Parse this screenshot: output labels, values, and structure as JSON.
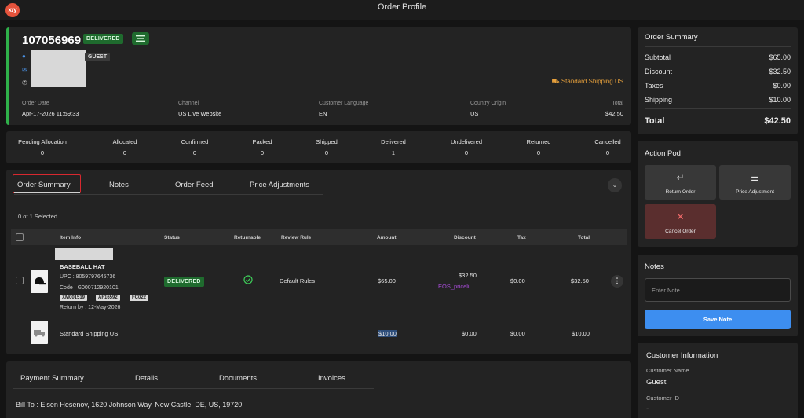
{
  "app": {
    "logo_text": "x/y",
    "title": "Order Profile"
  },
  "order": {
    "id": "107056969",
    "status_badge": "DELIVERED",
    "customer_tag": "GUEST",
    "shipping_method": "Standard Shipping US",
    "meta": [
      {
        "label": "Order Date",
        "value": "Apr-17-2026 11:59:33"
      },
      {
        "label": "Channel",
        "value": "US Live Website"
      },
      {
        "label": "Customer Language",
        "value": "EN"
      },
      {
        "label": "Country Origin",
        "value": "US"
      },
      {
        "label": "Total",
        "value": "$42.50"
      }
    ]
  },
  "status_counts": [
    {
      "label": "Pending Allocation",
      "value": "0"
    },
    {
      "label": "Allocated",
      "value": "0"
    },
    {
      "label": "Confirmed",
      "value": "0"
    },
    {
      "label": "Packed",
      "value": "0"
    },
    {
      "label": "Shipped",
      "value": "0"
    },
    {
      "label": "Delivered",
      "value": "1"
    },
    {
      "label": "Undelivered",
      "value": "0"
    },
    {
      "label": "Returned",
      "value": "0"
    },
    {
      "label": "Cancelled",
      "value": "0"
    }
  ],
  "tabs": [
    "Order Summary",
    "Notes",
    "Order Feed",
    "Price Adjustments"
  ],
  "selection_text": "0 of 1 Selected",
  "table": {
    "headers": [
      "Item Info",
      "Status",
      "Returnable",
      "Review Rule",
      "Amount",
      "Discount",
      "Tax",
      "Total"
    ],
    "item": {
      "name": "BASEBALL HAT",
      "upc": "UPC : 8059797645736",
      "code": "Code : G000712920101",
      "chips": [
        "XM001519",
        "AF16592",
        "FC022"
      ],
      "return_by": "Return by : 12-May-2026",
      "status": "DELIVERED",
      "review_rule": "Default Rules",
      "amount": "$65.00",
      "discount": "$32.50",
      "discount_code": "EOS_priceli...",
      "tax": "$0.00",
      "total": "$32.50"
    },
    "shipping_row": {
      "name": "Standard Shipping US",
      "amount": "$10.00",
      "discount": "$0.00",
      "tax": "$0.00",
      "total": "$10.00"
    }
  },
  "payment_tabs": [
    "Payment Summary",
    "Details",
    "Documents",
    "Invoices"
  ],
  "bill_to": "Bill To : Elsen Hesenov, 1620 Johnson Way, New Castle, DE, US, 19720",
  "order_summary": {
    "title": "Order Summary",
    "rows": [
      {
        "label": "Subtotal",
        "value": "$65.00"
      },
      {
        "label": "Discount",
        "value": "$32.50"
      },
      {
        "label": "Taxes",
        "value": "$0.00"
      },
      {
        "label": "Shipping",
        "value": "$10.00"
      }
    ],
    "total_label": "Total",
    "total_value": "$42.50"
  },
  "action_pod": {
    "title": "Action Pod",
    "return_label": "Return Order",
    "price_label": "Price Adjustment",
    "cancel_label": "Cancel Order"
  },
  "notes": {
    "title": "Notes",
    "placeholder": "Enter Note",
    "save_label": "Save Note"
  },
  "customer": {
    "title": "Customer Information",
    "name_label": "Customer Name",
    "name_value": "Guest",
    "id_label": "Customer ID",
    "id_value": "-"
  },
  "colors": {
    "accent_green": "#2fb14a",
    "delivered_badge": "#1f6b2e",
    "primary_button": "#3d8ef0",
    "cancel_bg": "#5a2e2e",
    "shipping_tag": "#e6a03c",
    "discount_code": "#a64bd6"
  }
}
